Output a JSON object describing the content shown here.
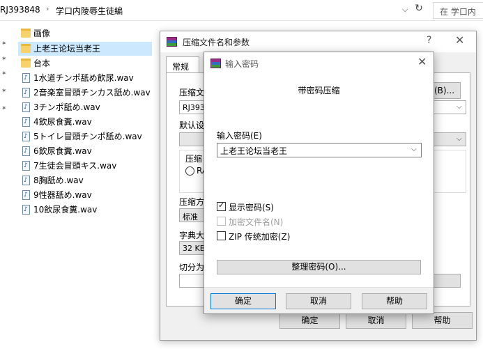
{
  "explorer": {
    "path_segments": [
      "RJ393848",
      "学口内陵辱生徒編"
    ],
    "search_placeholder": "在 学口内",
    "files": [
      {
        "name": "画像",
        "type": "folder"
      },
      {
        "name": "上老王论坛当老王",
        "type": "folder",
        "selected": true
      },
      {
        "name": "台本",
        "type": "folder"
      },
      {
        "name": "1水道チンポ舐め飲尿.wav",
        "type": "wav"
      },
      {
        "name": "2音楽室冒頭チンカス舐め.wav",
        "type": "wav"
      },
      {
        "name": "3チンポ舐め.wav",
        "type": "wav"
      },
      {
        "name": "4飲尿食糞.wav",
        "type": "wav"
      },
      {
        "name": "5トイレ冒頭チンポ舐め.wav",
        "type": "wav"
      },
      {
        "name": "6飲尿食糞.wav",
        "type": "wav"
      },
      {
        "name": "7生徒会冒頭キス.wav",
        "type": "wav"
      },
      {
        "name": "8胸舐め.wav",
        "type": "wav"
      },
      {
        "name": "9性器舐め.wav",
        "type": "wav"
      },
      {
        "name": "10飲尿食糞.wav",
        "type": "wav"
      }
    ]
  },
  "archive_dialog": {
    "title": "压缩文件名和参数",
    "help": "?",
    "close": "✕",
    "tab_general": "常规",
    "archive_name_label": "压缩文",
    "archive_name_value": "RJ393",
    "browse_button": "(B)...",
    "default_label": "默认设",
    "format_label": "压缩",
    "format_option": "RA",
    "method_label": "压缩方",
    "method_value": "标准",
    "dict_label": "字典大",
    "dict_value": "32 KB",
    "split_label": "切分为",
    "ok": "确定",
    "cancel": "取消",
    "help_button": "帮助"
  },
  "password_dialog": {
    "title": "输入密码",
    "close": "✕",
    "heading": "带密码压缩",
    "password_label": "输入密码(E)",
    "password_value": "上老王论坛当老王",
    "show_password": "显示密码(S)",
    "show_password_checked": true,
    "encrypt_names": "加密文件名(N)",
    "zip_legacy": "ZIP 传统加密(Z)",
    "organize_button": "整理密码(O)...",
    "ok": "确定",
    "cancel": "取消",
    "help": "帮助"
  }
}
